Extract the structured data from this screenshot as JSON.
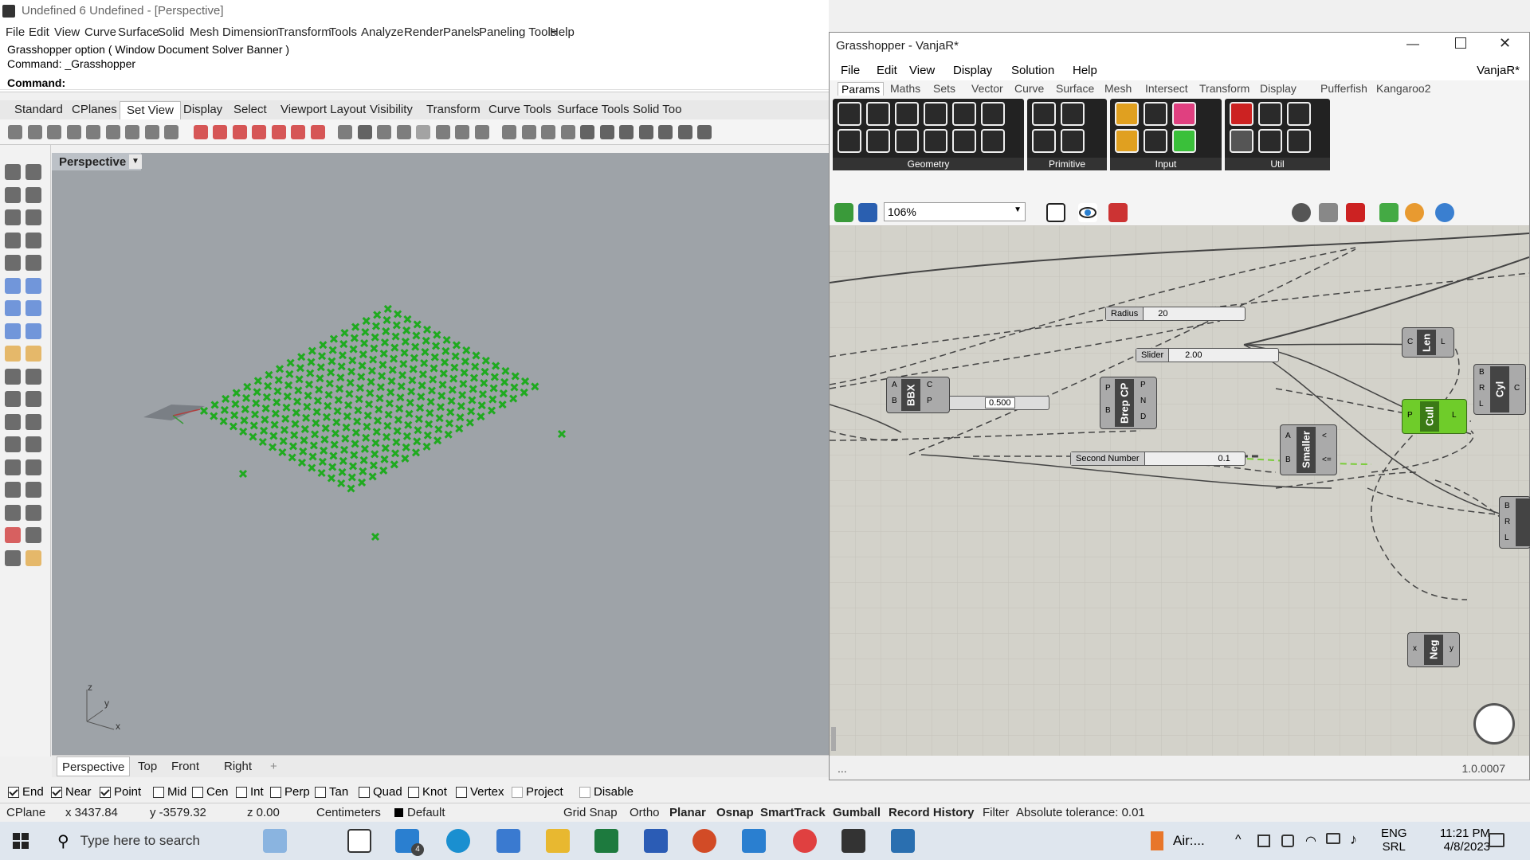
{
  "rhino": {
    "title": "Undefined 6 Undefined - [Perspective]",
    "menu": [
      "File",
      "Edit",
      "View",
      "Curve",
      "Surface",
      "Solid",
      "Mesh",
      "Dimension",
      "Transform",
      "Tools",
      "Analyze",
      "Render",
      "Panels",
      "Paneling Tools",
      "Help"
    ],
    "command_history_1": "Grasshopper option ( Window  Document  Solver  Banner )",
    "command_history_2": "Command: _Grasshopper",
    "command_prompt": "Command:",
    "tabs": [
      "Standard",
      "CPlanes",
      "Set View",
      "Display",
      "Select",
      "Viewport Layout",
      "Visibility",
      "Transform",
      "Curve Tools",
      "Surface Tools",
      "Solid Too"
    ],
    "active_tab": "Set View",
    "viewport_title": "Perspective",
    "viewport_tabs": [
      "Perspective",
      "Top",
      "Front",
      "Right"
    ],
    "add_viewport": "+",
    "axis_labels": {
      "z": "z",
      "y": "y",
      "x": "x"
    },
    "osnaps": [
      {
        "label": "End",
        "checked": true
      },
      {
        "label": "Near",
        "checked": true
      },
      {
        "label": "Point",
        "checked": true
      },
      {
        "label": "Mid",
        "checked": false
      },
      {
        "label": "Cen",
        "checked": false
      },
      {
        "label": "Int",
        "checked": false
      },
      {
        "label": "Perp",
        "checked": false
      },
      {
        "label": "Tan",
        "checked": false
      },
      {
        "label": "Quad",
        "checked": false
      },
      {
        "label": "Knot",
        "checked": false
      },
      {
        "label": "Vertex",
        "checked": false
      },
      {
        "label": "Project",
        "checked": false
      },
      {
        "label": "Disable",
        "checked": false
      }
    ],
    "status": {
      "cplane": "CPlane",
      "x": "x 3437.84",
      "y": "y -3579.32",
      "z": "z 0.00",
      "units": "Centimeters",
      "layer": "Default",
      "grid_snap": "Grid Snap",
      "ortho": "Ortho",
      "planar": "Planar",
      "osnap": "Osnap",
      "smarttrack": "SmartTrack",
      "gumball": "Gumball",
      "record_history": "Record History",
      "filter": "Filter",
      "tolerance": "Absolute tolerance: 0.01"
    },
    "point_color": "#1faa1f"
  },
  "grasshopper": {
    "title": "Grasshopper - VanjaR*",
    "doc_name": "VanjaR*",
    "menu": [
      "File",
      "Edit",
      "View",
      "Display",
      "Solution",
      "Help"
    ],
    "tabs": [
      "Params",
      "Maths",
      "Sets",
      "Vector",
      "Curve",
      "Surface",
      "Mesh",
      "Intersect",
      "Transform",
      "Display",
      "Pufferfish",
      "Kangaroo2"
    ],
    "active_tab": "Params",
    "ribbon_groups": [
      "Geometry",
      "Primitive",
      "Input",
      "Util"
    ],
    "zoom": "106%",
    "status_left": "...",
    "version": "1.0.0007",
    "nodes": {
      "radius_slider": {
        "name": "Radius",
        "value": "20"
      },
      "slider": {
        "name": "Slider",
        "value": "2.00"
      },
      "second_slider": {
        "name": "Second Number",
        "value": "0.1"
      },
      "number_slider_mid": {
        "value": "0.500"
      },
      "len": {
        "label": "Len",
        "in": "C",
        "out": "L"
      },
      "cyl": {
        "label": "Cyl",
        "in": [
          "B",
          "R",
          "L"
        ],
        "out": "C"
      },
      "bbx": {
        "label": "BBX",
        "in": [
          "A",
          "B"
        ],
        "out": [
          "C",
          "P"
        ]
      },
      "brep_cp": {
        "label": "Brep CP",
        "in": [
          "P",
          "B"
        ],
        "out": [
          "P",
          "N",
          "D"
        ]
      },
      "cull": {
        "label": "Cull",
        "in": "P",
        "out": "L"
      },
      "smaller": {
        "label": "Smaller",
        "in": [
          "A",
          "B"
        ],
        "out": [
          "<",
          "<="
        ]
      },
      "neg": {
        "label": "Neg",
        "in": "x",
        "out": "y"
      },
      "cyl2": {
        "in": [
          "B",
          "R",
          "L"
        ]
      }
    }
  },
  "taskbar": {
    "search_placeholder": "Type here to search",
    "mail_badge": "4",
    "weather": "Air:...",
    "lang": "ENG",
    "locale": "SRL",
    "time": "11:21 PM",
    "date": "4/8/2023"
  }
}
